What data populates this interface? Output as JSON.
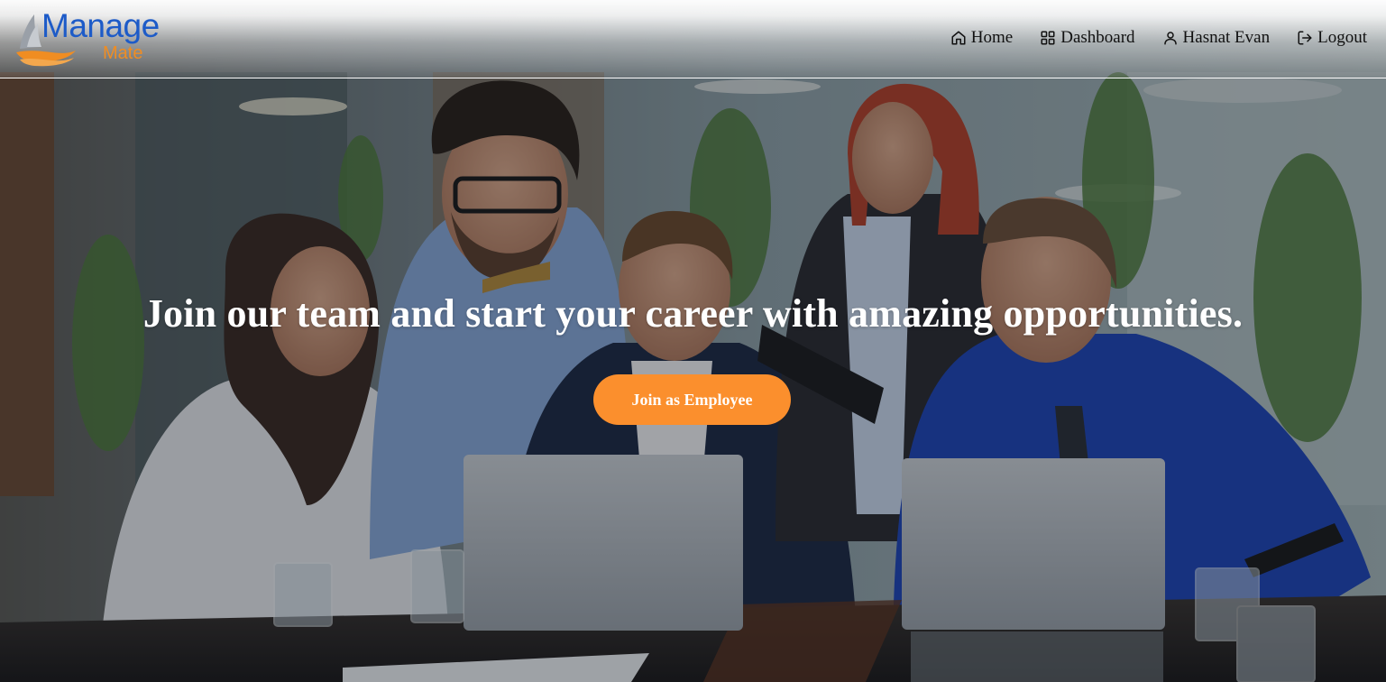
{
  "brand": {
    "logo_main": "Manage",
    "logo_sub": "Mate",
    "primary_color": "#1d5bc8",
    "accent_color": "#f08d22"
  },
  "nav": {
    "items": [
      {
        "label": "Home",
        "icon": "home-icon"
      },
      {
        "label": "Dashboard",
        "icon": "grid-icon"
      },
      {
        "label": "Hasnat Evan",
        "icon": "user-icon"
      },
      {
        "label": "Logout",
        "icon": "logout-icon"
      }
    ]
  },
  "hero": {
    "headline": "Join our team and start your career with amazing opportunities.",
    "cta_label": "Join as Employee",
    "cta_color": "#fb8f2d"
  }
}
